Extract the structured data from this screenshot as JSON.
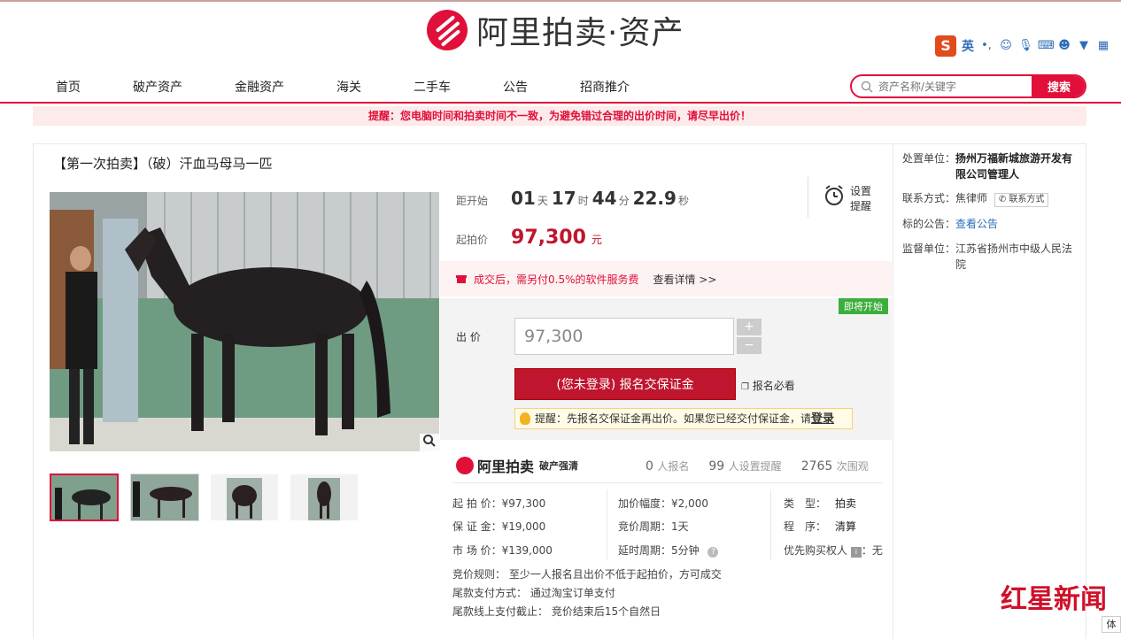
{
  "header": {
    "logo_text": "阿里拍卖·资产",
    "ime": {
      "lang": "英"
    }
  },
  "nav": {
    "items": [
      "首页",
      "破产资产",
      "金融资产",
      "海关",
      "二手车",
      "公告",
      "招商推介"
    ]
  },
  "search": {
    "placeholder": "资产名称/关键字",
    "button": "搜索"
  },
  "notice": "提醒：您电脑时间和拍卖时间不一致，为避免错过合理的出价时间，请尽早出价！",
  "item": {
    "title": "【第一次拍卖】（破）汗血马母马一匹"
  },
  "countdown": {
    "label": "距开始",
    "days": "01",
    "days_unit": "天",
    "hours": "17",
    "hours_unit": "时",
    "minutes": "44",
    "minutes_unit": "分",
    "seconds": "22.9",
    "seconds_unit": "秒",
    "reminder": "设置提醒"
  },
  "start_price": {
    "label": "起拍价",
    "value": "97,300",
    "unit": "元"
  },
  "fee": {
    "text": "成交后，需另付0.5%的软件服务费",
    "link": "查看详情 >>"
  },
  "bid": {
    "tag": "即将开始",
    "label": "出 价",
    "value": "97,300",
    "plus": "+",
    "minus": "−",
    "register_button": "(您未登录) 报名交保证金",
    "must_read": "报名必看",
    "tip": "提醒：先报名交保证金再出价。如果您已经交付保证金，请",
    "tip_login": "登录"
  },
  "brand": {
    "name": "阿里拍卖",
    "sub": "破产强清"
  },
  "stats": {
    "signups": "0",
    "signups_unit": "人报名",
    "reminders": "99",
    "reminders_unit": "人设置提醒",
    "views": "2765",
    "views_unit": "次围观"
  },
  "details": {
    "start_price": "起 拍 价：¥97,300",
    "deposit": "保 证 金：¥19,000",
    "market_price": "市 场 价：¥139,000",
    "increment": "加价幅度：¥2,000",
    "period": "竞价周期：1天",
    "delay": "延时周期：5分钟",
    "type_label": "类　型：",
    "type_value": "拍卖",
    "procedure_label": "程　序：",
    "procedure_value": "清算",
    "priority_label": "优先购买权人",
    "priority_value": "：无",
    "rule": "竞价规则： 至少一人报名且出价不低于起拍价，方可成交",
    "payment": "尾款支付方式： 通过淘宝订单支付",
    "deadline": "尾款线上支付截止： 竞价结束后15个自然日"
  },
  "side": {
    "disposer_label": "处置单位：",
    "disposer_value": "扬州万福新城旅游开发有限公司管理人",
    "contact_label": "联系方式：",
    "contact_name": "焦律师",
    "contact_button": "联系方式",
    "announcement_label": "标的公告：",
    "announcement_link": "查看公告",
    "supervisor_label": "监督单位：",
    "supervisor_value": "江苏省扬州市中级人民法院"
  },
  "watermark": "红星新闻",
  "corner": "体",
  "colors": {
    "brand_red": "#e0103a",
    "price_red": "#c0152f",
    "start_tag_green": "#3cae3c"
  }
}
